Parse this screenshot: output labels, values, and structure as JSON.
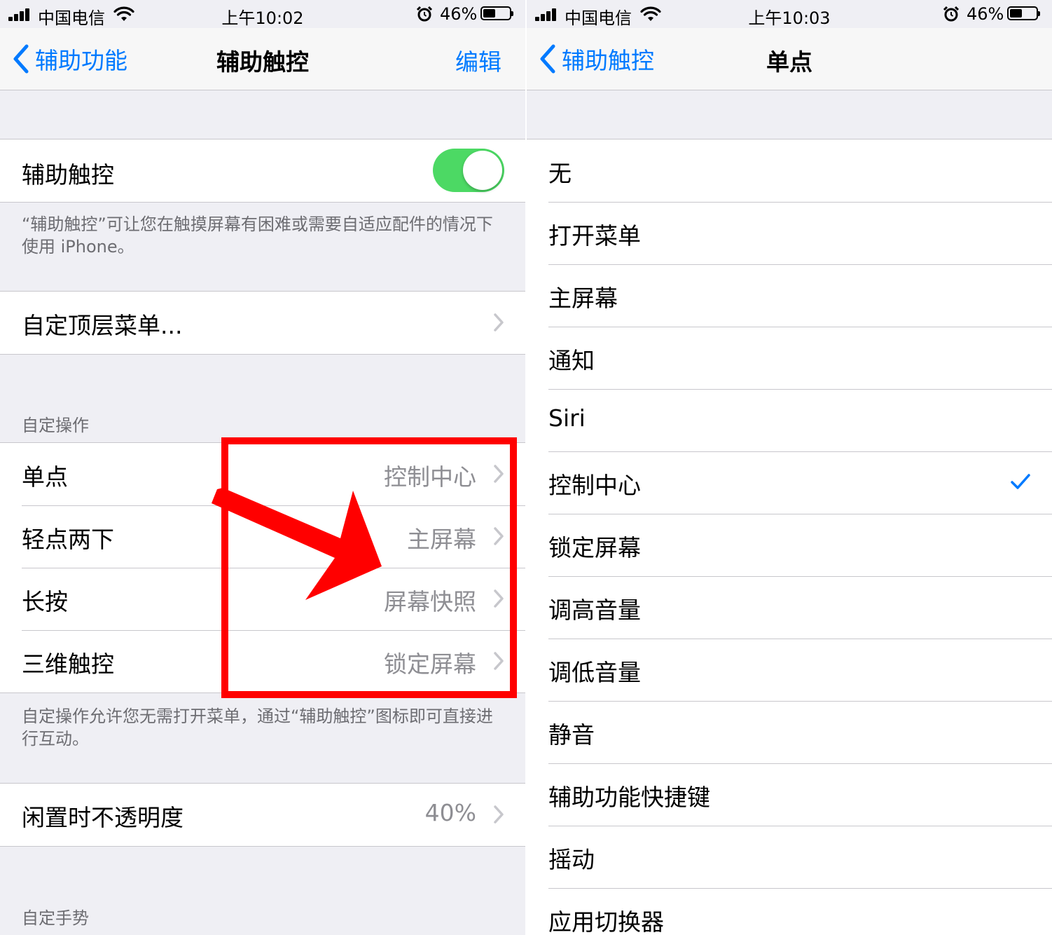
{
  "colors": {
    "accent": "#007aff",
    "toggle_on": "#4cd964",
    "annotation": "#ff0000"
  },
  "left": {
    "status": {
      "carrier": "中国电信",
      "time": "上午10:02",
      "battery_pct": "46%",
      "battery_level": 0.46
    },
    "nav": {
      "back_label": "辅助功能",
      "title": "辅助触控",
      "right_label": "编辑"
    },
    "toggle_row": {
      "label": "辅助触控",
      "on": true
    },
    "toggle_footer": "“辅助触控”可让您在触摸屏幕有困难或需要自适应配件的情况下使用 iPhone。",
    "top_menu_row": {
      "label": "自定顶层菜单..."
    },
    "custom_actions": {
      "header": "自定操作",
      "rows": [
        {
          "label": "单点",
          "value": "控制中心"
        },
        {
          "label": "轻点两下",
          "value": "主屏幕"
        },
        {
          "label": "长按",
          "value": "屏幕快照"
        },
        {
          "label": "三维触控",
          "value": "锁定屏幕"
        }
      ],
      "footer": "自定操作允许您无需打开菜单，通过“辅助触控”图标即可直接进行互动。"
    },
    "idle_row": {
      "label": "闲置时不透明度",
      "value": "40%"
    },
    "gestures_header": "自定手势"
  },
  "right": {
    "status": {
      "carrier": "中国电信",
      "time": "上午10:03",
      "battery_pct": "46%",
      "battery_level": 0.46
    },
    "nav": {
      "back_label": "辅助触控",
      "title": "单点"
    },
    "options": [
      {
        "label": "无"
      },
      {
        "label": "打开菜单"
      },
      {
        "label": "主屏幕"
      },
      {
        "label": "通知"
      },
      {
        "label": "Siri"
      },
      {
        "label": "控制中心",
        "selected": true
      },
      {
        "label": "锁定屏幕"
      },
      {
        "label": "调高音量"
      },
      {
        "label": "调低音量"
      },
      {
        "label": "静音"
      },
      {
        "label": "辅助功能快捷键"
      },
      {
        "label": "摇动"
      },
      {
        "label": "应用切换器"
      }
    ]
  }
}
